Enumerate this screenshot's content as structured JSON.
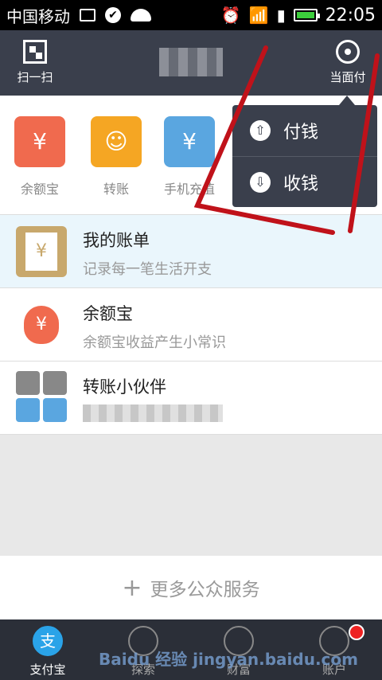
{
  "status_bar": {
    "carrier": "中国移动",
    "time": "22:05",
    "battery_level": 1.0
  },
  "header": {
    "scan_label": "扫一扫",
    "pay_face_label": "当面付",
    "bg_color": "#3a3f4c"
  },
  "quick_apps": [
    {
      "label": "余额宝",
      "icon": "money-bag-icon",
      "color": "#f06a4e"
    },
    {
      "label": "转账",
      "icon": "transfer-icon",
      "color": "#f5a623"
    },
    {
      "label": "手机充值",
      "icon": "phone-recharge-icon",
      "color": "#5aa6e0"
    }
  ],
  "popup_menu": {
    "items": [
      {
        "label": "付钱",
        "icon": "pay-upload-icon"
      },
      {
        "label": "收钱",
        "icon": "receive-download-icon"
      }
    ]
  },
  "list": [
    {
      "title": "我的账单",
      "subtitle": "记录每一笔生活开支",
      "icon": "bill-icon"
    },
    {
      "title": "余额宝",
      "subtitle": "余额宝收益产生小常识",
      "icon": "money-bag-icon"
    },
    {
      "title": "转账小伙伴",
      "subtitle": "",
      "icon": "friends-avatars-icon"
    }
  ],
  "more_services": {
    "label": "更多公众服务"
  },
  "tabbar": {
    "tabs": [
      {
        "label": "支付宝",
        "icon": "alipay-icon",
        "active": true
      },
      {
        "label": "探索",
        "icon": "globe-icon",
        "active": false
      },
      {
        "label": "财富",
        "icon": "wealth-icon",
        "active": false
      },
      {
        "label": "账户",
        "icon": "account-icon",
        "active": false
      }
    ]
  },
  "watermark": "Baidu 经验 jingyan.baidu.com",
  "accent_color": "#2aa3e8"
}
